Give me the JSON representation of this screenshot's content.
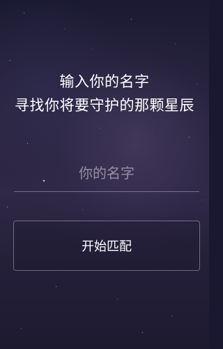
{
  "headline": {
    "line1": "输入你的名字",
    "line2": "寻找你将要守护的那颗星辰"
  },
  "name_input": {
    "value": "",
    "placeholder": "你的名字"
  },
  "start_button": {
    "label": "开始匹配"
  },
  "colors": {
    "background_top": "#1b1a32",
    "background_mid": "#2f2846",
    "text": "#ffffff",
    "placeholder": "#b4afc3",
    "border": "#afaac3"
  }
}
